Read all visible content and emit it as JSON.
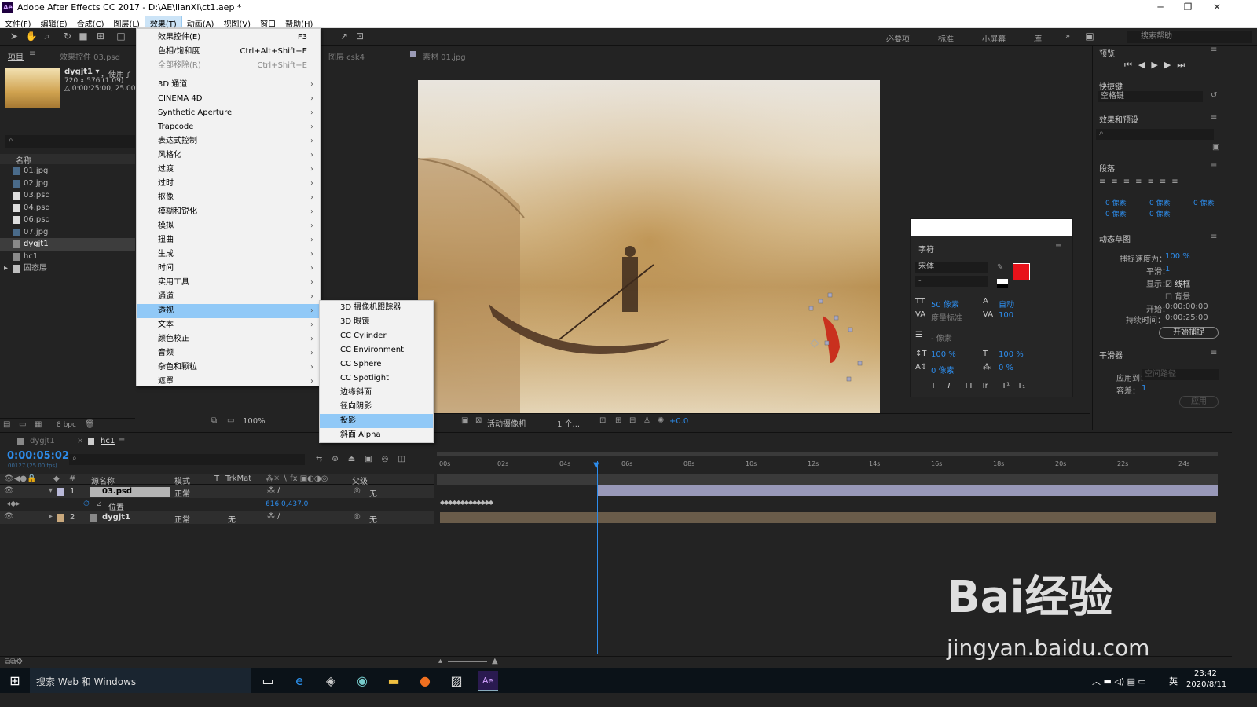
{
  "window": {
    "title": "Adobe After Effects CC 2017 - D:\\AE\\lianXi\\ct1.aep *",
    "app_icon": "Ae"
  },
  "menubar": [
    "文件(F)",
    "编辑(E)",
    "合成(C)",
    "图层(L)",
    "效果(T)",
    "动画(A)",
    "视图(V)",
    "窗口",
    "帮助(H)"
  ],
  "workspaces": [
    "必要项",
    "标准",
    "小屏幕",
    "库"
  ],
  "help_search": "搜索帮助",
  "project": {
    "tab": "项目",
    "effect_tab": "效果控件 03.psd",
    "item_name": "dygjt1 ▾",
    "used": "，使用了",
    "info1": "720 x 576 (1.09)",
    "info2": "△ 0:00:25:00, 25.00 f",
    "name_header": "名称",
    "items": [
      "01.jpg",
      "02.jpg",
      "03.psd",
      "04.psd",
      "06.psd",
      "07.jpg",
      "dygjt1",
      "hc1",
      "固态层"
    ],
    "bpc": "8 bpc"
  },
  "effects_menu": {
    "top": [
      {
        "label": "效果控件(E)",
        "shortcut": "F3"
      },
      {
        "label": "色相/饱和度",
        "shortcut": "Ctrl+Alt+Shift+E"
      },
      {
        "label": "全部移除(R)",
        "shortcut": "Ctrl+Shift+E"
      }
    ],
    "items": [
      "3D 通道",
      "CINEMA 4D",
      "Synthetic Aperture",
      "Trapcode",
      "表达式控制",
      "风格化",
      "过渡",
      "过时",
      "抠像",
      "模糊和锐化",
      "模拟",
      "扭曲",
      "生成",
      "时间",
      "实用工具",
      "通道",
      "透视",
      "文本",
      "颜色校正",
      "音频",
      "杂色和颗粒",
      "遮罩"
    ]
  },
  "perspective_menu": [
    "3D 摄像机跟踪器",
    "3D 眼镜",
    "CC Cylinder",
    "CC Environment",
    "CC Sphere",
    "CC Spotlight",
    "边缘斜面",
    "径向阴影",
    "投影",
    "斜面 Alpha"
  ],
  "comp": {
    "layer_tab": "图层 csk4",
    "footage_tab": "素材 01.jpg",
    "zoom": "100%",
    "camera": "活动摄像机",
    "views": "1 个...",
    "offset": "+0.0"
  },
  "character": {
    "title": "字符",
    "font": "宋体",
    "style": "-",
    "size": "50 像素",
    "leading": "自动",
    "kerning": "度量标准",
    "tracking": "100",
    "stroke": "- 像素",
    "vscale": "100 %",
    "hscale": "100 %",
    "baseline": "0 像素",
    "tsume": "0 %",
    "styles": [
      "T",
      "T",
      "TT",
      "Tr",
      "T¹",
      "T₁"
    ]
  },
  "right": {
    "preview": "预览",
    "shortcut_label": "快捷键",
    "shortcut_val": "空格键",
    "effects_presets": "效果和预设",
    "paragraph": "段落",
    "indent": [
      "0 像素",
      "0 像素",
      "0 像素",
      "0 像素",
      "0 像素"
    ],
    "motion_sketch": "动态草图",
    "capture_speed_label": "捕捉速度为：",
    "capture_speed": "100 %",
    "smooth_label": "平滑：",
    "smooth": "1",
    "show_label": "显示：",
    "wireframe": "线框",
    "background": "背景",
    "start_label": "开始：",
    "start": "0:00:00:00",
    "duration_label": "持续时间：",
    "duration": "0:00:25:00",
    "capture_btn": "开始捕捉",
    "smoother": "平滑器",
    "apply_to_label": "应用到：",
    "apply_to": "空间路径",
    "tolerance_label": "容差：",
    "tolerance": "1",
    "apply_btn": "应用"
  },
  "timeline": {
    "tabs": [
      "dygjt1",
      "hc1"
    ],
    "timecode": "0:00:05:02",
    "frame": "00127 (25.00 fps)",
    "cols": [
      "源名称",
      "模式",
      "T",
      "TrkMat",
      "父级"
    ],
    "layers": [
      {
        "num": "1",
        "name": "03.psd",
        "mode": "正常",
        "trk": "",
        "parent": "无"
      },
      {
        "num": "2",
        "name": "dygjt1",
        "mode": "正常",
        "trk": "无",
        "parent": "无"
      }
    ],
    "prop": "位置",
    "prop_val": "616.0,437.0",
    "ruler": [
      "00s",
      "02s",
      "04s",
      "06s",
      "08s",
      "10s",
      "12s",
      "14s",
      "16s",
      "18s",
      "20s",
      "22s",
      "24s"
    ]
  },
  "taskbar": {
    "search": "搜索 Web 和 Windows",
    "time": "23:42",
    "date": "2020/8/11",
    "ime": "英"
  },
  "watermark": {
    "brand": "Bai经验",
    "url": "jingyan.baidu.com"
  }
}
